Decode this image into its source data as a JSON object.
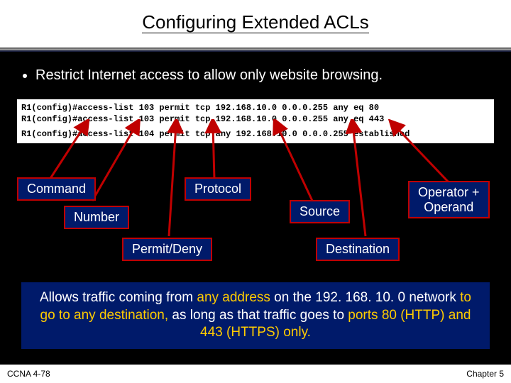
{
  "title": "Configuring Extended ACLs",
  "bullet": "Restrict Internet access to allow only website browsing.",
  "code": {
    "line1": "R1(config)#access-list 103 permit tcp 192.168.10.0 0.0.0.255 any eq 80",
    "line2": "R1(config)#access-list 103 permit tcp 192.168.10.0 0.0.0.255 any eq 443",
    "line3": "R1(config)#access-list 104 permit tcp any 192.168.10.0 0.0.0.255 established"
  },
  "labels": {
    "command": "Command",
    "protocol": "Protocol",
    "number": "Number",
    "source": "Source",
    "permit_deny": "Permit/Deny",
    "destination": "Destination",
    "operator_operand_l1": "Operator +",
    "operator_operand_l2": "Operand"
  },
  "explain": {
    "t1": "Allows traffic coming from ",
    "h1": "any address",
    "t2": " on the 192. 168. 10. 0 network ",
    "h2": "to go to any destination,",
    "t3": " as long as that traffic goes to ",
    "h3": "ports 80 (HTTP) and 443 (HTTPS) only.",
    "t4": ""
  },
  "footer": {
    "left": "CCNA 4-78",
    "right": "Chapter 5"
  },
  "colors": {
    "label_bg": "#001a6a",
    "label_border": "#c00000",
    "highlight": "#ffcc00",
    "arrow": "#c00000"
  }
}
